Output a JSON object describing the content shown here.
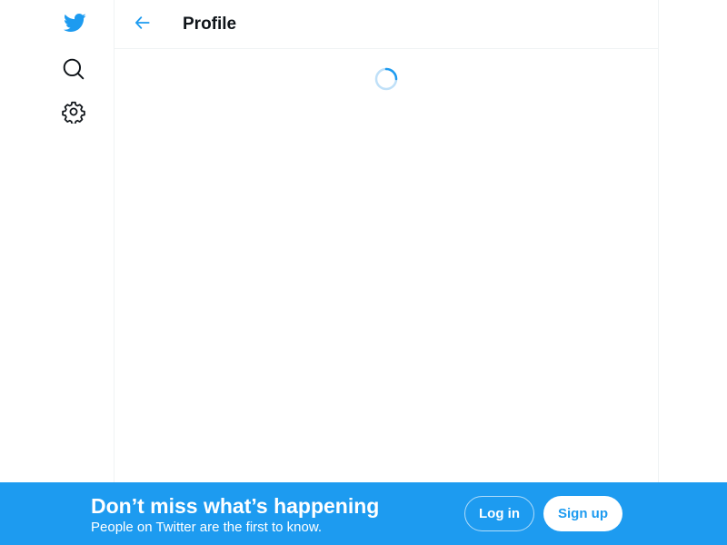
{
  "app": {
    "name": "Twitter",
    "brand_color": "#1d9bf0"
  },
  "sidebar": {
    "items": [
      {
        "id": "logo",
        "icon": "twitter-bird-icon"
      },
      {
        "id": "explore",
        "icon": "search-icon"
      },
      {
        "id": "settings",
        "icon": "gear-icon"
      }
    ]
  },
  "header": {
    "back_icon": "arrow-left-icon",
    "title": "Profile"
  },
  "content": {
    "state": "loading",
    "spinner_icon": "loading-spinner-icon"
  },
  "bottom_bar": {
    "headline": "Don’t miss what’s happening",
    "subtext": "People on Twitter are the first to know.",
    "login_label": "Log in",
    "signup_label": "Sign up",
    "background_color": "#1d9bf0"
  }
}
